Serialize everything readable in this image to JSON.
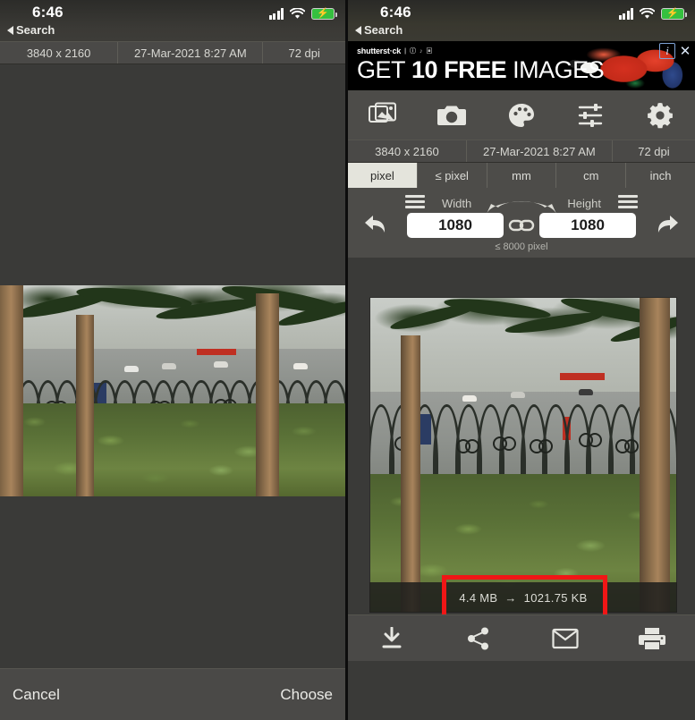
{
  "left_screen": {
    "status_bar": {
      "time": "6:46",
      "back_label": "Search",
      "signal_icon": "signal-bars-icon",
      "wifi_icon": "wifi-icon",
      "battery_icon": "battery-charging-icon"
    },
    "metadata": {
      "dimensions": "3840 x 2160",
      "date": "27-Mar-2021 8:27 AM",
      "dpi": "72 dpi"
    },
    "bottom_bar": {
      "cancel_label": "Cancel",
      "choose_label": "Choose"
    }
  },
  "right_screen": {
    "status_bar": {
      "time": "6:46",
      "back_label": "Search",
      "signal_icon": "signal-bars-icon",
      "wifi_icon": "wifi-icon",
      "battery_icon": "battery-charging-icon"
    },
    "ad": {
      "brand": "shutterst·ck",
      "brand_suffix": "| ⓘ ♪ ▣",
      "headline_1": "GET",
      "headline_2": "10",
      "headline_3": "FREE",
      "headline_4": "IMAGES",
      "info_icon": "info-icon",
      "close_icon": "close-icon"
    },
    "toolbar": {
      "items": [
        {
          "name": "photo-library-icon",
          "label": "Photos"
        },
        {
          "name": "camera-icon",
          "label": "Camera"
        },
        {
          "name": "palette-icon",
          "label": "Color"
        },
        {
          "name": "sliders-icon",
          "label": "Adjust"
        },
        {
          "name": "gear-icon",
          "label": "Settings"
        }
      ]
    },
    "metadata": {
      "dimensions": "3840 x 2160",
      "date": "27-Mar-2021 8:27 AM",
      "dpi": "72 dpi"
    },
    "unit_tabs": [
      {
        "label": "pixel",
        "active": true
      },
      {
        "label": "≤ pixel",
        "active": false
      },
      {
        "label": "mm",
        "active": false
      },
      {
        "label": "cm",
        "active": false
      },
      {
        "label": "inch",
        "active": false
      }
    ],
    "size_controls": {
      "undo_icon": "undo-icon",
      "redo_icon": "redo-icon",
      "width_label": "Width",
      "height_label": "Height",
      "width_value": "1080",
      "height_value": "1080",
      "link_icon": "link-chain-icon",
      "swap_icon": "swap-arrows-icon",
      "max_hint": "≤ 8000 pixel",
      "width_menu_icon": "hamburger-menu-icon",
      "height_menu_icon": "hamburger-menu-icon"
    },
    "preview": {
      "file_size_before": "4.4 MB",
      "file_size_arrow": "→",
      "file_size_after": "1021.75 KB",
      "highlight_color": "#f01616"
    },
    "bottom_bar": {
      "items": [
        {
          "name": "download-icon",
          "label": "Download"
        },
        {
          "name": "share-icon",
          "label": "Share"
        },
        {
          "name": "email-icon",
          "label": "Email"
        },
        {
          "name": "print-icon",
          "label": "Print"
        }
      ]
    }
  }
}
